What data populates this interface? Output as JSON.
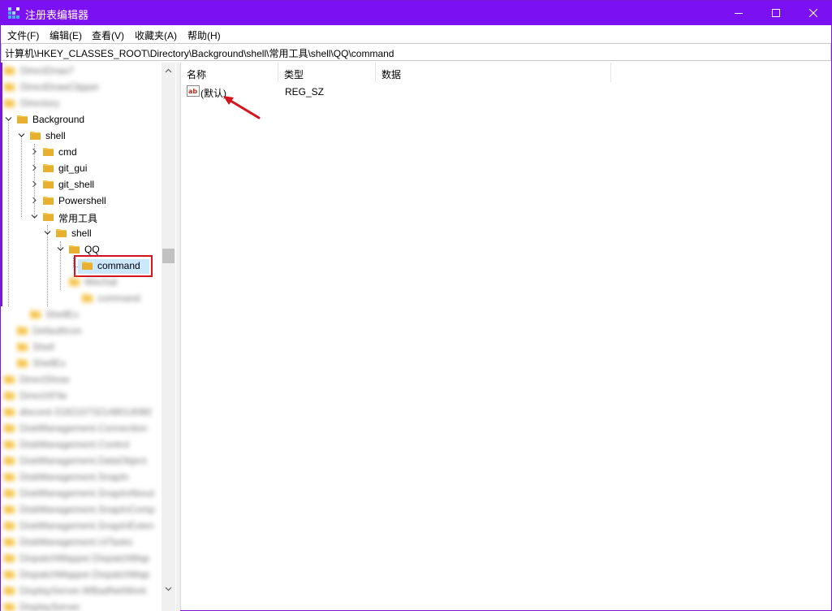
{
  "window": {
    "title": "注册表编辑器",
    "accent_color": "#7b10f2"
  },
  "menu": {
    "items": [
      "文件(F)",
      "编辑(E)",
      "查看(V)",
      "收藏夹(A)",
      "帮助(H)"
    ]
  },
  "address": {
    "path": "计算机\\HKEY_CLASSES_ROOT\\Directory\\Background\\shell\\常用工具\\shell\\QQ\\command"
  },
  "tree": {
    "nodes": [
      {
        "label": "Background",
        "expanded": true
      },
      {
        "label": "shell",
        "expanded": true
      },
      {
        "label": "cmd",
        "expanded": false
      },
      {
        "label": "git_gui",
        "expanded": false
      },
      {
        "label": "git_shell",
        "expanded": false
      },
      {
        "label": "Powershell",
        "expanded": false
      },
      {
        "label": "常用工具",
        "expanded": true
      },
      {
        "label": "shell",
        "expanded": true
      },
      {
        "label": "QQ",
        "expanded": true
      },
      {
        "label": "command",
        "selected": true
      }
    ]
  },
  "list": {
    "columns": [
      "名称",
      "类型",
      "数据"
    ],
    "rows": [
      {
        "name": "(默认)",
        "type": "REG_SZ",
        "data": ""
      }
    ]
  },
  "highlight_color": "#d4141c"
}
